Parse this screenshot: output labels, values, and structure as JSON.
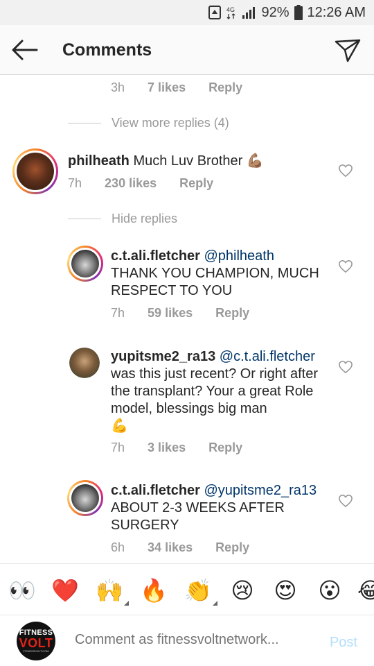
{
  "status_bar": {
    "battery": "92%",
    "time": "12:26 AM",
    "icons": [
      "nfc-icon",
      "data-4g-icon",
      "signal-icon",
      "battery-icon"
    ]
  },
  "header": {
    "title": "Comments",
    "back_icon": "back-arrow-icon",
    "send_icon": "direct-send-icon"
  },
  "top_meta": {
    "time": "3h",
    "likes": "7 likes",
    "reply": "Reply"
  },
  "view_more_replies": "View more replies (4)",
  "hide_replies": "Hide replies",
  "comments": [
    {
      "username": "philheath",
      "text": "Much Luv Brother",
      "emoji": "💪🏽",
      "time": "7h",
      "likes": "230 likes",
      "reply": "Reply"
    }
  ],
  "replies": [
    {
      "username": "c.t.ali.fletcher",
      "mention": "@philheath",
      "text": "THANK YOU CHAMPION, MUCH RESPECT TO YOU",
      "time": "7h",
      "likes": "59 likes",
      "reply": "Reply"
    },
    {
      "username": "yupitsme2_ra13",
      "mention": "@c.t.ali.fletcher",
      "text": "was this just recent? Or right after the transplant? Your a great Role model, blessings big man",
      "emoji": "💪",
      "time": "7h",
      "likes": "3 likes",
      "reply": "Reply"
    },
    {
      "username": "c.t.ali.fletcher",
      "mention": "@yupitsme2_ra13",
      "text": "ABOUT 2-3 WEEKS AFTER SURGERY",
      "time": "6h",
      "likes": "34 likes",
      "reply": "Reply"
    }
  ],
  "emoji_bar": [
    "👀",
    "❤️",
    "🙌",
    "🔥",
    "👏",
    "😢",
    "😍",
    "😮",
    "😂"
  ],
  "composer": {
    "placeholder": "Comment as fitnessvoltnetwork...",
    "post_label": "Post",
    "avatar_text_top": "FITNESS",
    "avatar_text_mid": "VOLT",
    "avatar_text_sub": "FITNESSVOLT.COM"
  },
  "colors": {
    "mention": "#003569",
    "meta_gray": "#999999",
    "post_disabled": "#b2dffc"
  }
}
